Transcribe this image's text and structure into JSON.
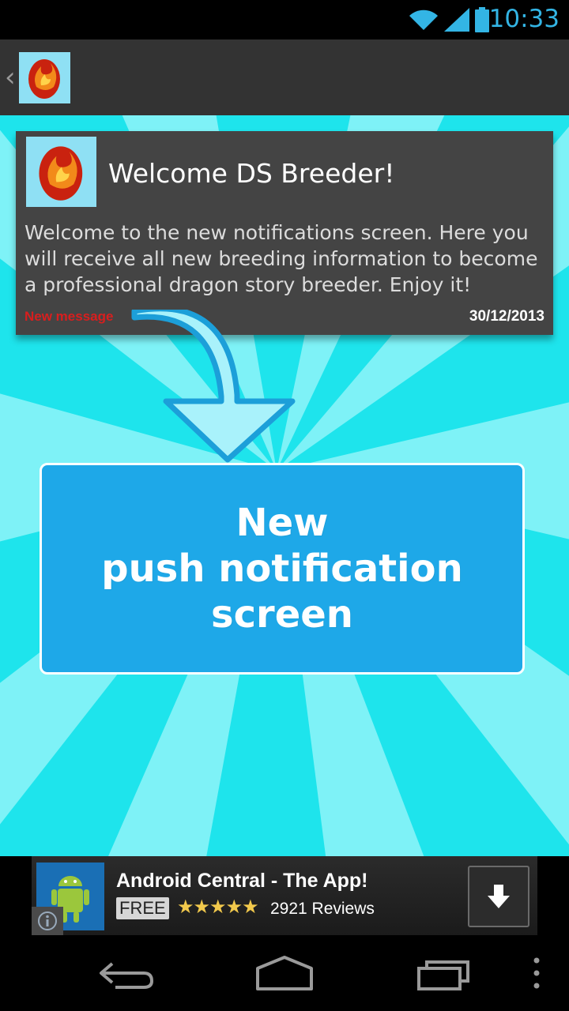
{
  "status_bar": {
    "time": "10:33",
    "accent": "#33b5e5"
  },
  "action_bar": {
    "icon": "dragon-egg-icon"
  },
  "notification": {
    "title": "Welcome DS Breeder!",
    "body": "Welcome to the new notifications screen. Here you will receive all new breeding information to become a professional dragon story breeder. Enjoy it!",
    "tag": "New message",
    "date": "30/12/2013"
  },
  "banner": {
    "line1": "New",
    "line2": "push notification",
    "line3": "screen"
  },
  "ad": {
    "title": "Android Central - The App!",
    "price": "FREE",
    "rating": 4.5,
    "stars": "★★★★★",
    "reviews": "2921 Reviews"
  },
  "colors": {
    "background_light": "#7ef2f7",
    "background_dark": "#1ee4ec",
    "card": "#444444",
    "banner": "#1ea8e8",
    "tag_red": "#d81e1e"
  }
}
